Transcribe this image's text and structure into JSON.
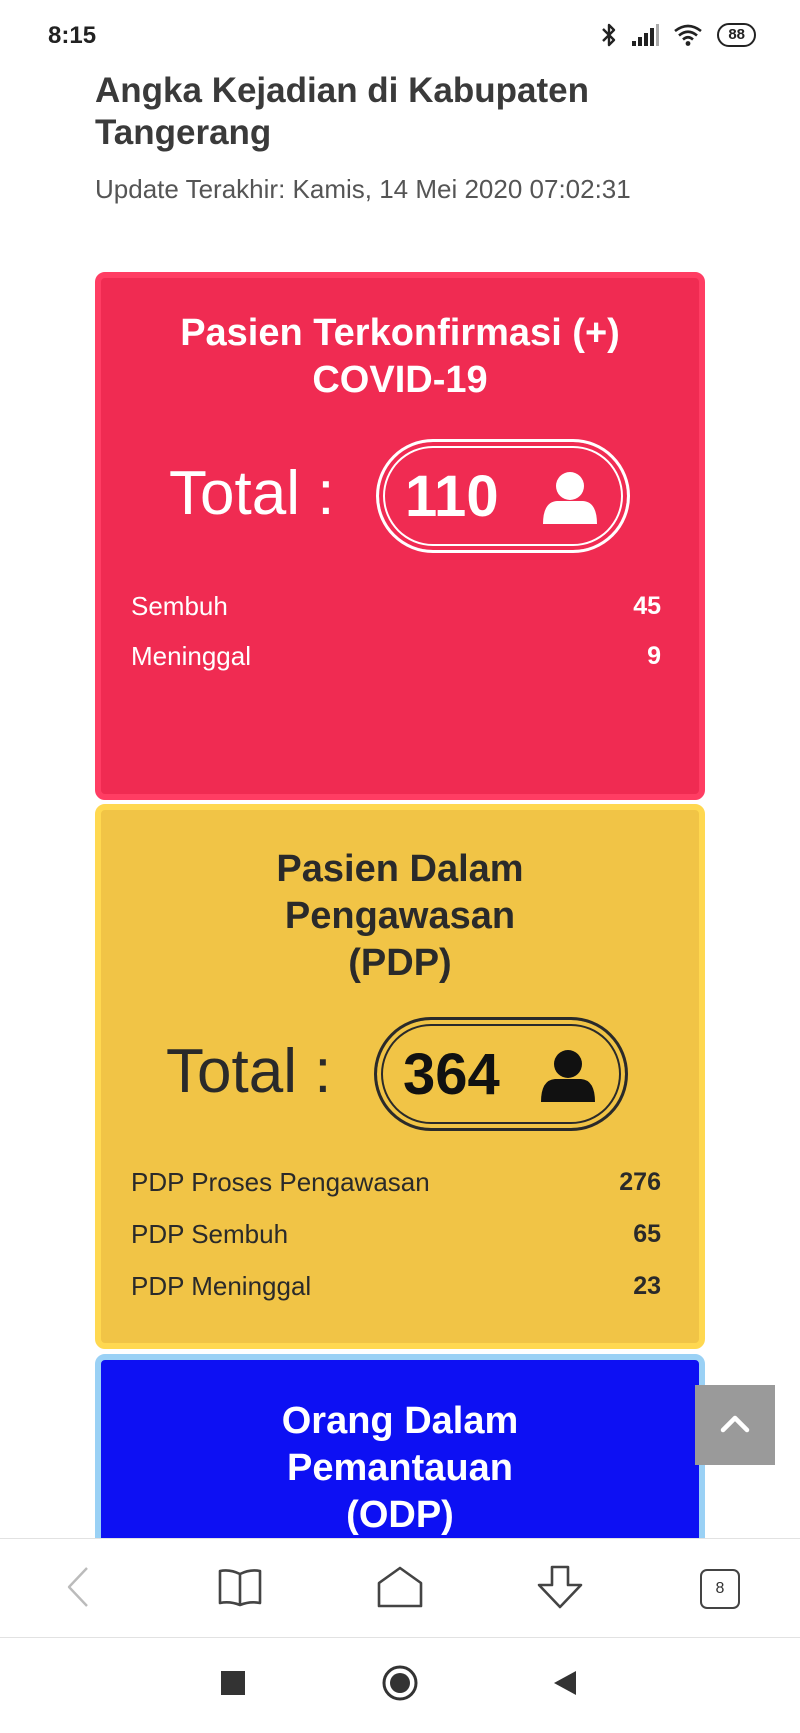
{
  "status_bar": {
    "time": "8:15",
    "battery": "88"
  },
  "header": {
    "title": "Angka Kejadian di Kabupaten Tangerang",
    "update": "Update Terakhir: Kamis, 14 Mei 2020 07:02:31"
  },
  "cards": {
    "confirmed": {
      "title_line1": "Pasien Terkonfirmasi (+)",
      "title_line2": "COVID-19",
      "total_label": "Total :",
      "total_value": "110",
      "color": "#f02b52",
      "stats": [
        {
          "label": "Sembuh",
          "value": "45"
        },
        {
          "label": "Meninggal",
          "value": "9"
        }
      ]
    },
    "pdp": {
      "title_line1": "Pasien Dalam",
      "title_line2": "Pengawasan",
      "title_line3": "(PDP)",
      "total_label": "Total :",
      "total_value": "364",
      "color": "#f1c446",
      "stats": [
        {
          "label": "PDP Proses Pengawasan",
          "value": "276"
        },
        {
          "label": "PDP Sembuh",
          "value": "65"
        },
        {
          "label": "PDP Meninggal",
          "value": "23"
        }
      ]
    },
    "odp": {
      "title_line1": "Orang Dalam",
      "title_line2": "Pemantauan",
      "title_line3": "(ODP)",
      "color": "#0d10f3"
    }
  },
  "browser_toolbar": {
    "tab_count": "8",
    "icons": [
      "back-icon",
      "bookmarks-icon",
      "home-icon",
      "download-icon",
      "tabs-icon"
    ]
  },
  "android_nav": {
    "icons": [
      "recents-icon",
      "home-icon",
      "back-icon"
    ]
  }
}
